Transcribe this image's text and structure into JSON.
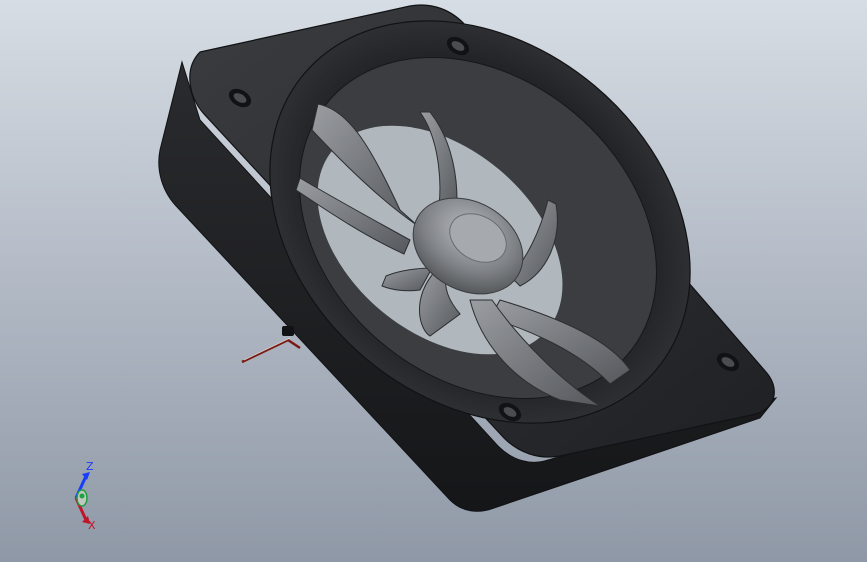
{
  "model": {
    "part": "fan-assembly",
    "body_color": "#2b2d30",
    "body_edge_color": "#1b1c1e",
    "impeller_color": "#6f7276",
    "hub_color": "#8a8d91",
    "cable_color": "#7a1a12"
  },
  "triad": {
    "z_label": "Z",
    "x_label": "X",
    "z_color": "#1a3cff",
    "x_color": "#c0142a",
    "y_color": "#20a040"
  }
}
